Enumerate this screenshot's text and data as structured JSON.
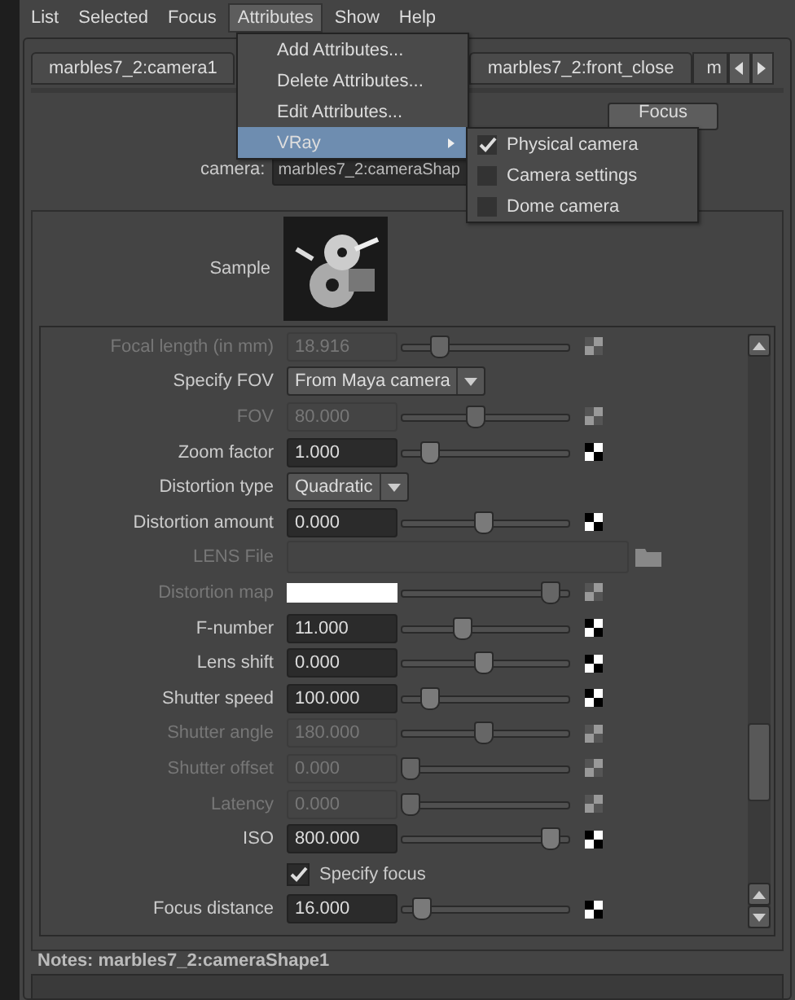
{
  "menubar": [
    {
      "label": "List",
      "selected": false
    },
    {
      "label": "Selected",
      "selected": false
    },
    {
      "label": "Focus",
      "selected": false
    },
    {
      "label": "Attributes",
      "selected": true
    },
    {
      "label": "Show",
      "selected": false
    },
    {
      "label": "Help",
      "selected": false
    }
  ],
  "attributes_menu": {
    "items": [
      {
        "label": "Add Attributes...",
        "selected": false,
        "has_submenu": false
      },
      {
        "label": "Delete Attributes...",
        "selected": false,
        "has_submenu": false
      },
      {
        "label": "Edit Attributes...",
        "selected": false,
        "has_submenu": false
      },
      {
        "label": "VRay",
        "selected": true,
        "has_submenu": true
      }
    ]
  },
  "vray_submenu": {
    "items": [
      {
        "label": "Physical camera",
        "checked": true
      },
      {
        "label": "Camera settings",
        "checked": false
      },
      {
        "label": "Dome camera",
        "checked": false
      }
    ]
  },
  "tabs": [
    {
      "label": "marbles7_2:camera1"
    },
    {
      "label": "marbles7_2:front_close"
    },
    {
      "label": "m"
    }
  ],
  "focus_button": "Focus",
  "camera": {
    "label": "camera:",
    "value": "marbles7_2:cameraShap"
  },
  "sample_label": "Sample",
  "attributes": [
    {
      "kind": "slider",
      "label": "Focal length (in mm)",
      "value": "18.916",
      "level": 0.2,
      "disabled": true
    },
    {
      "kind": "dropdown",
      "label": "Specify FOV",
      "value": "From Maya camera"
    },
    {
      "kind": "slider",
      "label": "FOV",
      "value": "80.000",
      "level": 0.44,
      "disabled": true
    },
    {
      "kind": "slider",
      "label": "Zoom factor",
      "value": "1.000",
      "level": 0.13,
      "disabled": false
    },
    {
      "kind": "dropdown",
      "label": "Distortion type",
      "value": "Quadratic"
    },
    {
      "kind": "slider",
      "label": "Distortion amount",
      "value": "0.000",
      "level": 0.49,
      "disabled": false
    },
    {
      "kind": "file",
      "label": "LENS File",
      "disabled": true
    },
    {
      "kind": "color",
      "label": "Distortion map",
      "level": 0.94,
      "disabled": true
    },
    {
      "kind": "slider",
      "label": "F-number",
      "value": "11.000",
      "level": 0.35,
      "disabled": false
    },
    {
      "kind": "slider",
      "label": "Lens shift",
      "value": "0.000",
      "level": 0.49,
      "disabled": false
    },
    {
      "kind": "slider",
      "label": "Shutter speed",
      "value": "100.000",
      "level": 0.13,
      "disabled": false
    },
    {
      "kind": "slider",
      "label": "Shutter angle",
      "value": "180.000",
      "level": 0.49,
      "disabled": true
    },
    {
      "kind": "slider",
      "label": "Shutter offset",
      "value": "0.000",
      "level": 0.0,
      "disabled": true
    },
    {
      "kind": "slider",
      "label": "Latency",
      "value": "0.000",
      "level": 0.0,
      "disabled": true
    },
    {
      "kind": "slider",
      "label": "ISO",
      "value": "800.000",
      "level": 0.94,
      "disabled": false
    },
    {
      "kind": "checkbox",
      "label": "Specify focus",
      "checked": true
    },
    {
      "kind": "slider",
      "label": "Focus distance",
      "value": "16.000",
      "level": 0.08,
      "disabled": false
    }
  ],
  "notes": {
    "label": "Notes:  marbles7_2:cameraShape1"
  }
}
